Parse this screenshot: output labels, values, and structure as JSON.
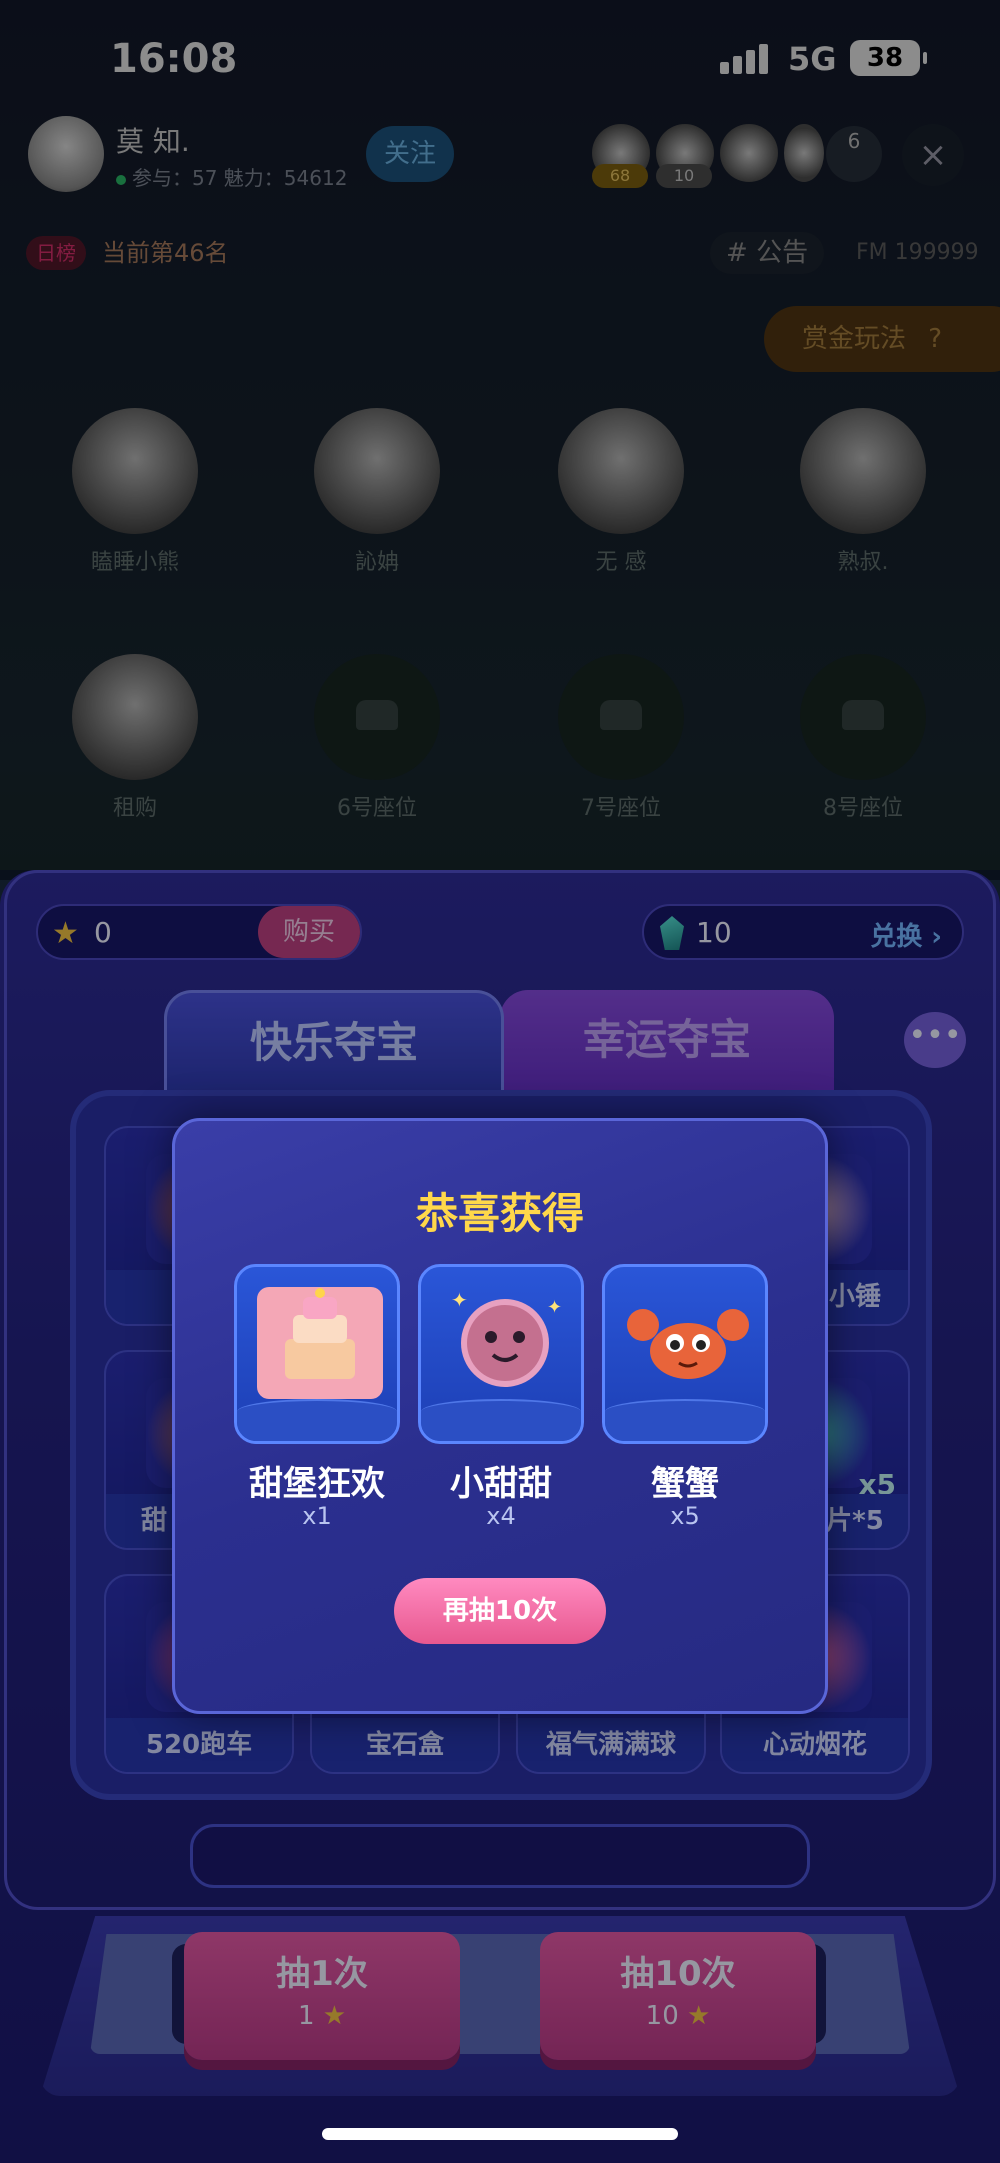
{
  "status_bar": {
    "time": "16:08",
    "network": "5G",
    "battery": "38"
  },
  "room": {
    "host_name": "莫 知.",
    "host_stats": "参与：57 魅力：54612",
    "follow_label": "关注",
    "viewer_badges": [
      "68",
      "10"
    ],
    "viewer_count": "6",
    "close_icon": "×",
    "rank_tag": "日榜",
    "rank_text": "当前第46名",
    "notice_label": "公告",
    "fm_id": "FM 199999",
    "bounty_label": "赏金玩法",
    "seats": [
      {
        "name": "瞌睡小熊"
      },
      {
        "name": "訫姌"
      },
      {
        "name": "无  感"
      },
      {
        "name": "熟叔."
      },
      {
        "name": "租购"
      },
      {
        "name": "6号座位"
      },
      {
        "name": "7号座位"
      },
      {
        "name": "8号座位"
      }
    ]
  },
  "game": {
    "coins": "0",
    "buy_label": "购买",
    "gems": "10",
    "exchange_label": "兑换 ›",
    "tab_active": "快乐夺宝",
    "tab_inactive": "幸运夺宝",
    "more_icon": "•••",
    "board_labels": {
      "top_right": "小锤",
      "mid_left": "甜",
      "mid_right": "片*5",
      "mid_right_badge": "x5",
      "bottom": [
        "520跑车",
        "宝石盒",
        "福气满满球",
        "心动烟花"
      ]
    },
    "draw_buttons": [
      {
        "title": "抽1次",
        "cost": "1"
      },
      {
        "title": "抽10次",
        "cost": "10"
      }
    ],
    "star_icon": "★"
  },
  "modal": {
    "title": "恭喜获得",
    "prizes": [
      {
        "name": "甜堡狂欢",
        "qty": "x1"
      },
      {
        "name": "小甜甜",
        "qty": "x4"
      },
      {
        "name": "蟹蟹",
        "qty": "x5"
      }
    ],
    "redraw_label": "再抽10次"
  }
}
